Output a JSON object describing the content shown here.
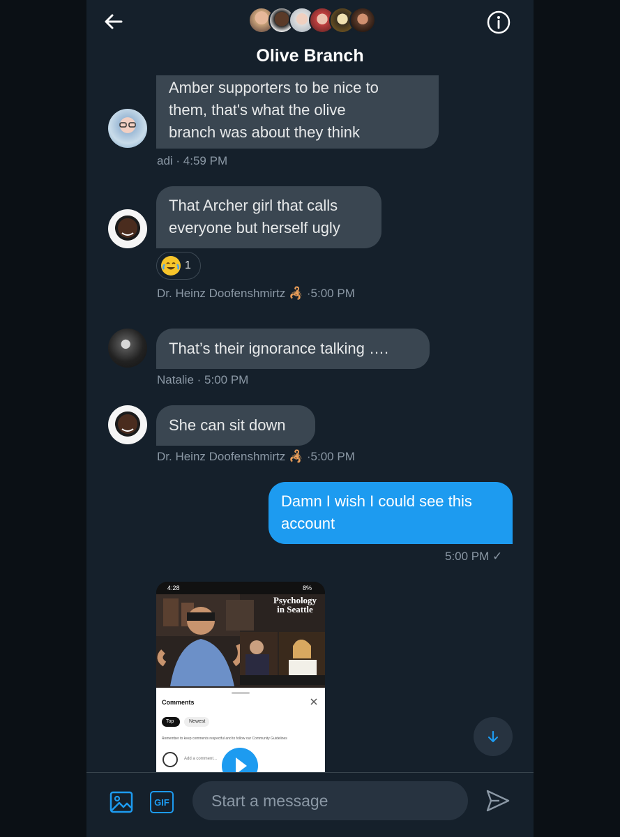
{
  "header": {
    "title": "Olive Branch",
    "back_icon": "arrow-left-icon",
    "info_icon": "info-circle-icon"
  },
  "messages": [
    {
      "sender": "adi",
      "text_lines": [
        "Amber supporters to be nice to",
        "them, that's what the olive",
        "branch was about they think"
      ],
      "meta_prefix": "adi · ",
      "time": "4:59 PM"
    },
    {
      "sender": "Dr. Heinz Doofenshmirtz",
      "text_lines": [
        "That Archer girl that calls",
        "everyone but herself ugly"
      ],
      "meta_prefix": "Dr. Heinz Doofenshmirtz",
      "time": "5:00 PM",
      "reaction": {
        "emoji": "face-with-tears-of-joy",
        "count": "1"
      }
    },
    {
      "sender": "Natalie",
      "text_lines": [
        "That’s their ignorance talking …."
      ],
      "meta_prefix": "Natalie · ",
      "time": "5:00 PM"
    },
    {
      "sender": "Dr. Heinz Doofenshmirtz",
      "text_lines": [
        "She can sit down"
      ],
      "meta_prefix": "Dr. Heinz Doofenshmirtz",
      "time": "5:00 PM"
    },
    {
      "sender": "me",
      "text_lines": [
        "Damn I wish I could see this",
        "account"
      ],
      "time": "5:00 PM ✓"
    }
  ],
  "media": {
    "status_time": "4:28",
    "battery": "8%",
    "overlay_line1": "Psychology",
    "overlay_line2": "in Seattle",
    "comments_title": "Comments",
    "chip_top": "Top",
    "chip_newest": "Newest",
    "guidelines": "Remember to keep comments respectful and to follow our Community Guidelines",
    "add_comment": "Add a comment..."
  },
  "composer": {
    "placeholder": "Start a message",
    "gif_label": "GIF"
  },
  "colors": {
    "background": "#15202b",
    "incoming_bubble": "#3a4651",
    "outgoing_bubble": "#1d9bf0",
    "muted_text": "#8b98a5"
  }
}
